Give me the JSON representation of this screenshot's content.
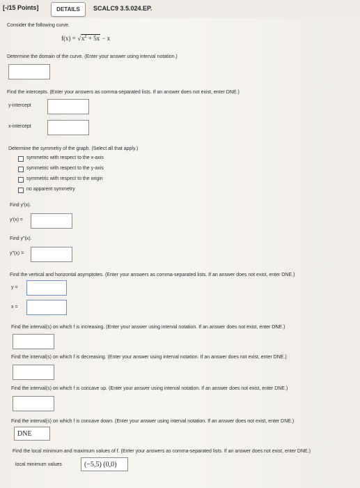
{
  "header": {
    "points": "[-/15 Points]",
    "details_label": "DETAILS",
    "problem_code": "SCALC9 3.5.024.EP."
  },
  "intro": {
    "consider": "Consider the following curve.",
    "func_lhs": "f(x) =",
    "func_root": "x",
    "func_exp": "2",
    "func_root_tail": "+ 5x",
    "func_tail": "− x"
  },
  "domain": {
    "prompt": "Determine the domain of the curve. (Enter your answer using interval notation.)"
  },
  "intercepts": {
    "prompt": "Find the intercepts. (Enter your answers as comma-separated lists. If an answer does not exist, enter DNE.)",
    "y_label": "y-intercept",
    "x_label": "x-intercept"
  },
  "symmetry": {
    "prompt": "Determine the symmetry of the graph. (Select all that apply.)",
    "options": [
      "symmetric with respect to the x-axis",
      "symmetric with respect to the y-axis",
      "symmetric with respect to the origin",
      "no apparent symmetry"
    ]
  },
  "derivatives": {
    "find_first": "Find y′(x).",
    "first_label": "y′(x) =",
    "find_second": "Find y″(x).",
    "second_label": "y″(x) ="
  },
  "asymptotes": {
    "prompt": "Find the vertical and horizontal asymptotes. (Enter your answers as comma-separated lists. If an answer does not exist, enter DNE.)",
    "y_label": "y =",
    "x_label": "x ="
  },
  "intervals": {
    "increasing": "Find the interval(s) on which f is increasing. (Enter your answer using interval notation. If an answer does not exist, enter DNE.)",
    "decreasing": "Find the interval(s) on which f is decreasing. (Enter your answer using interval notation. If an answer does not exist, enter DNE.)",
    "concave_up": "Find the interval(s) on which f is concave up. (Enter your answer using interval notation. If an answer does not exist, enter DNE.)",
    "concave_down": "Find the interval(s) on which f is concave down. (Enter your answer using interval notation. If an answer does not exist, enter DNE.)",
    "concave_down_value": "DNE"
  },
  "extrema": {
    "prompt": "Find the local minimum and maximum values of f. (Enter your answers as comma-separated lists. If an answer does not exist, enter DNE.)",
    "min_label": "local minimum values",
    "min_value": "(−5,5) (0,0)"
  }
}
